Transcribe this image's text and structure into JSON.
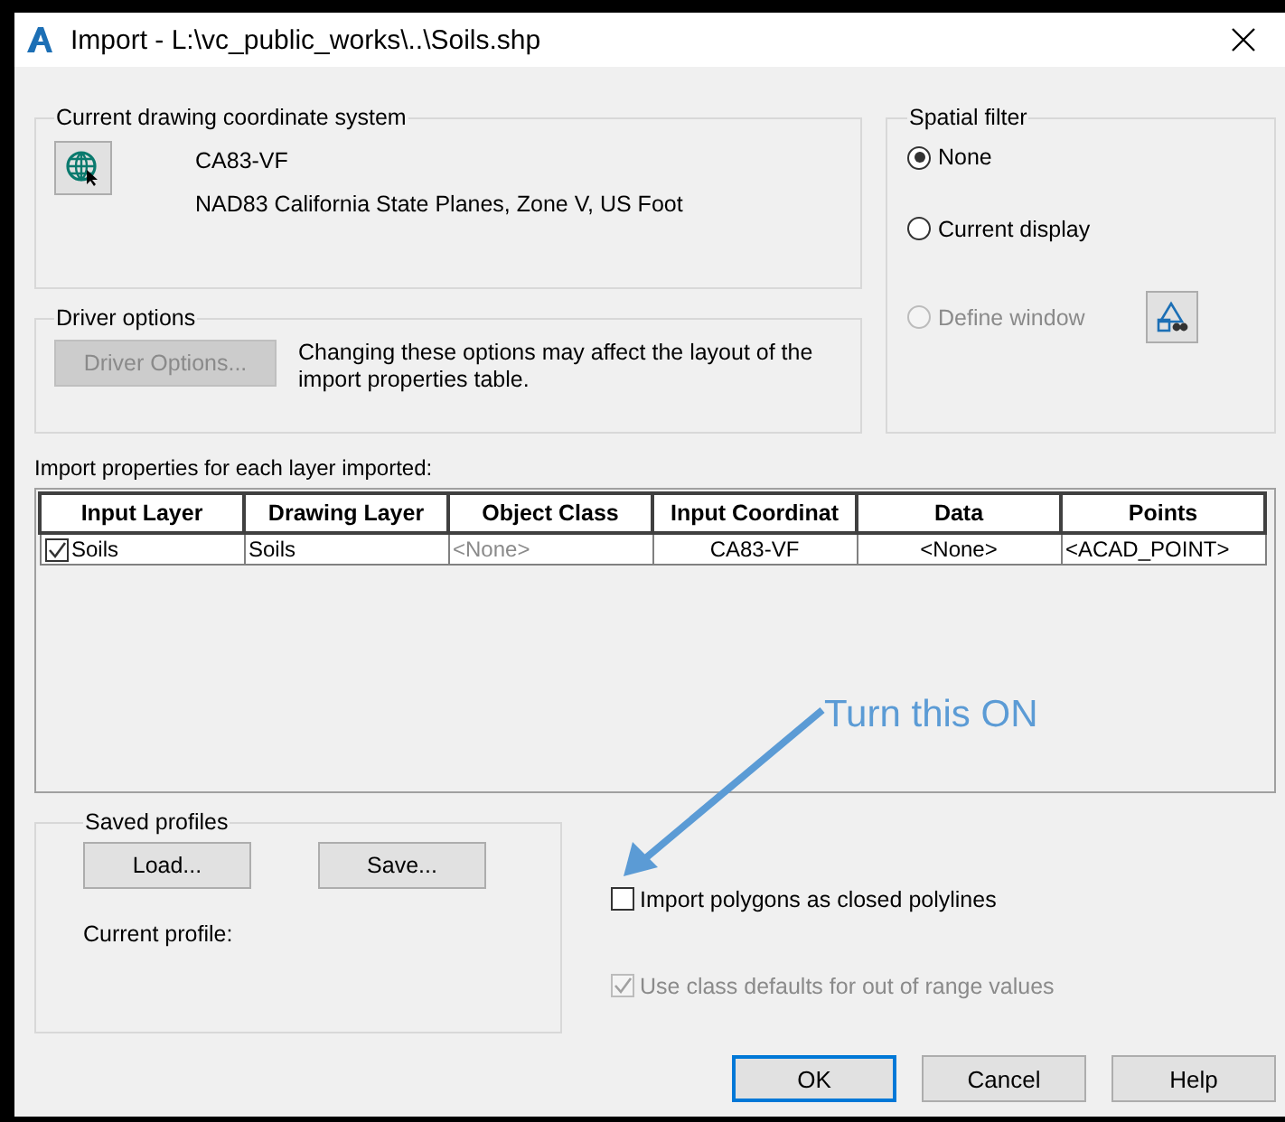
{
  "window": {
    "title": "Import - L:\\vc_public_works\\..\\Soils.shp"
  },
  "coordinate_system": {
    "title": "Current drawing coordinate system",
    "code": "CA83-VF",
    "description": "NAD83 California State Planes, Zone V, US Foot"
  },
  "driver_options": {
    "title": "Driver options",
    "button": {
      "label": "Driver Options...",
      "disabled": true
    },
    "note": "Changing these options may affect the layout of the import properties table."
  },
  "spatial_filter": {
    "title": "Spatial filter",
    "options": [
      {
        "label": "None",
        "selected": true,
        "disabled": false
      },
      {
        "label": "Current display",
        "selected": false,
        "disabled": false
      },
      {
        "label": "Define window",
        "selected": false,
        "disabled": true
      }
    ]
  },
  "table_label": "Import properties for each layer imported:",
  "table": {
    "columns": [
      "Input Layer",
      "Drawing Layer",
      "Object Class",
      "Input Coordinat",
      "Data",
      "Points"
    ],
    "rows": [
      {
        "checked": true,
        "cells": [
          {
            "text": "Soils",
            "dimmed": false
          },
          {
            "text": "Soils",
            "dimmed": false
          },
          {
            "text": "<None>",
            "dimmed": true
          },
          {
            "text": "CA83-VF",
            "dimmed": false
          },
          {
            "text": "<None>",
            "dimmed": false
          },
          {
            "text": "<ACAD_POINT>",
            "dimmed": false
          }
        ]
      }
    ]
  },
  "saved_profiles": {
    "title": "Saved profiles",
    "buttons": [
      "Load...",
      "Save..."
    ],
    "current_profile": "Current profile:"
  },
  "options": [
    {
      "label": "Import polygons as closed polylines",
      "checked": false,
      "disabled": false
    },
    {
      "label": "Use class defaults for out of range values",
      "checked": true,
      "disabled": true
    }
  ],
  "buttons": [
    {
      "label": "OK",
      "default": true
    },
    {
      "label": "Cancel",
      "default": false
    },
    {
      "label": "Help",
      "default": false
    }
  ],
  "annotation": {
    "text": "Turn this ON"
  }
}
